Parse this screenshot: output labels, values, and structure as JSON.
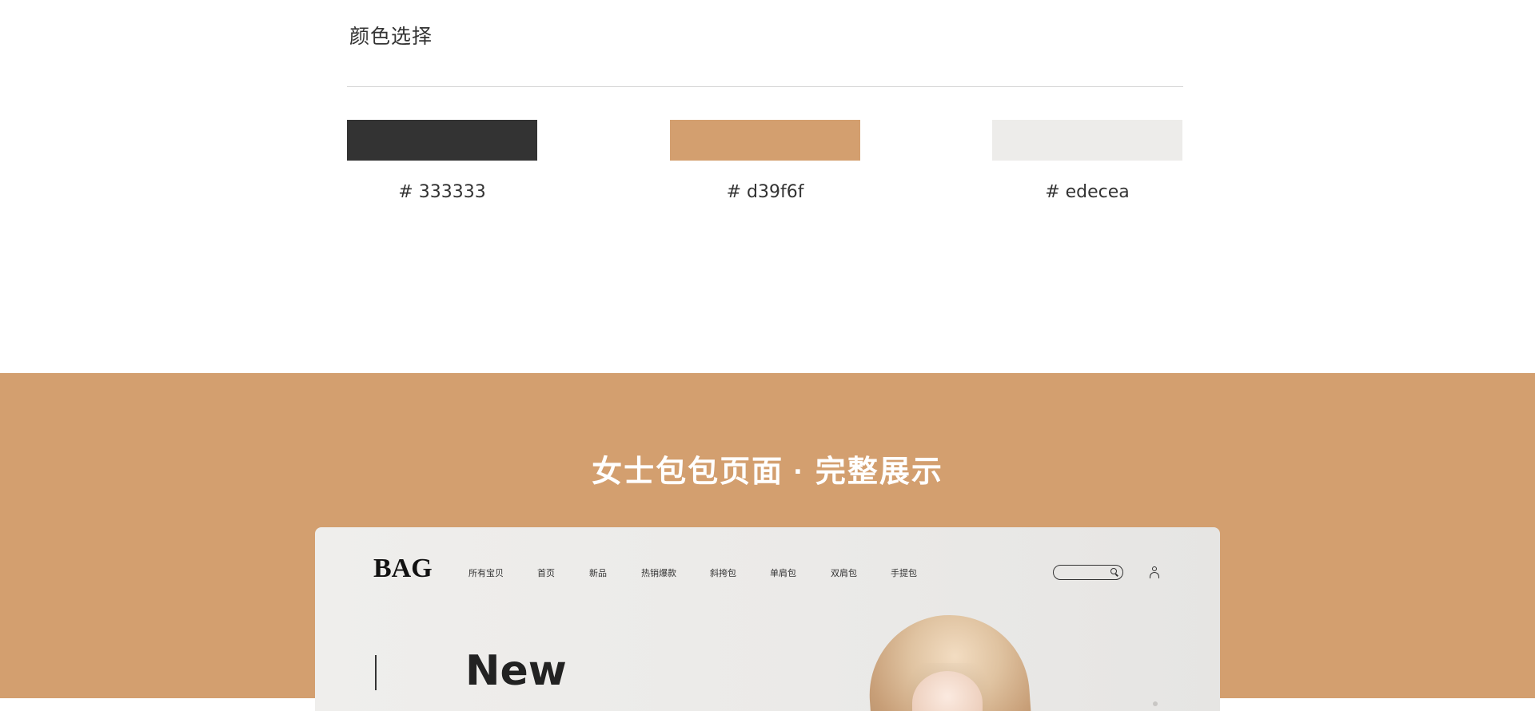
{
  "top": {
    "title": "颜色选择",
    "swatches": [
      {
        "color": "#333333",
        "label": "# 333333"
      },
      {
        "color": "#d39f6f",
        "label": "# d39f6f"
      },
      {
        "color": "#edecea",
        "label": "# edecea"
      }
    ]
  },
  "bottom": {
    "title": "女士包包页面 · 完整展示",
    "mockup": {
      "brand": "BAG",
      "nav": [
        "所有宝贝",
        "首页",
        "新品",
        "热销爆款",
        "斜挎包",
        "单肩包",
        "双肩包",
        "手提包"
      ],
      "hero_word": "New"
    }
  },
  "colors": {
    "accent": "#d39f6f",
    "dark": "#333333",
    "light": "#edecea"
  }
}
